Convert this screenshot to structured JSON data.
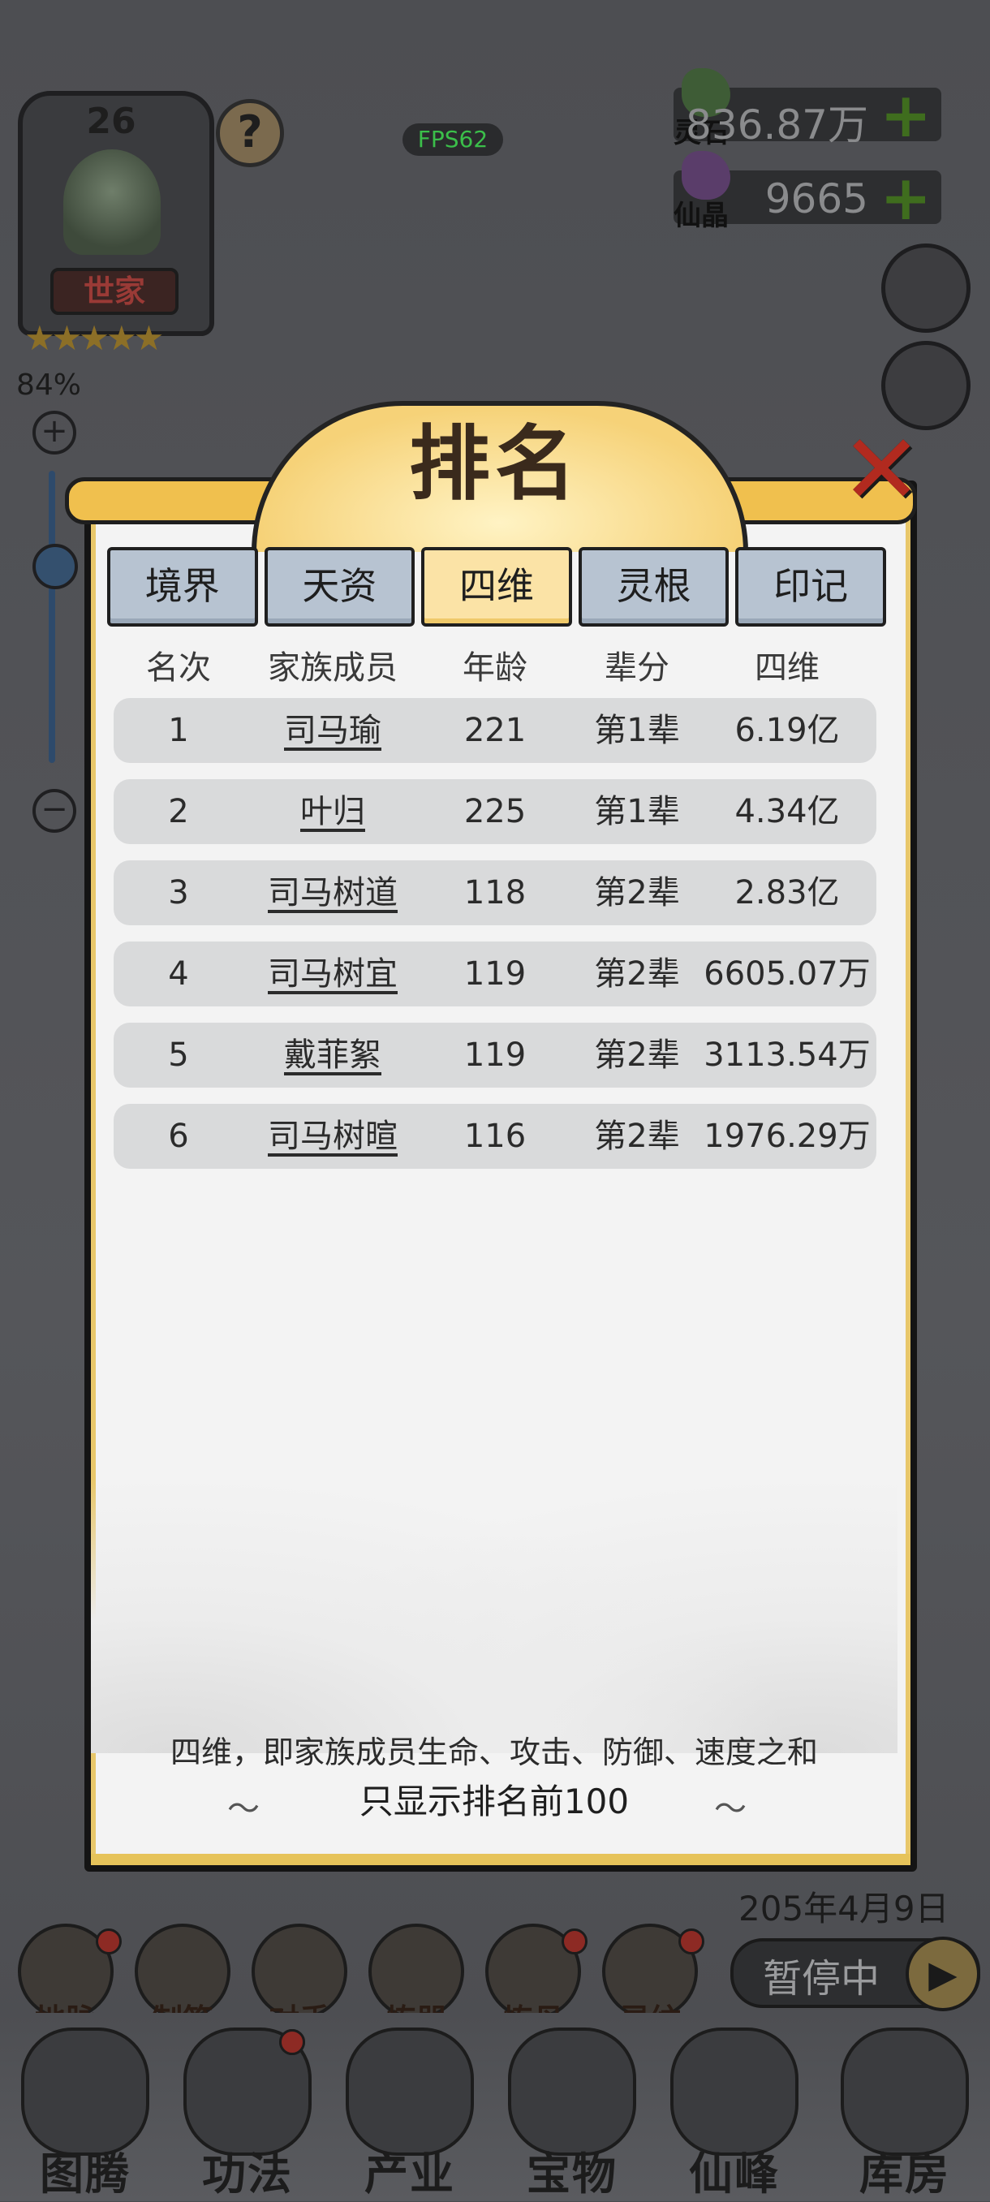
{
  "hud": {
    "level": "26",
    "family_title": "世家",
    "stars": "★★★★★",
    "percent": "84%",
    "fps": "FPS62",
    "help": "?",
    "plus_zoom": "+",
    "minus_zoom": "−"
  },
  "resources": [
    {
      "label": "灵石",
      "value": "836.87万",
      "plus": "+"
    },
    {
      "label": "仙晶",
      "value": "9665",
      "plus": "+"
    }
  ],
  "dialog": {
    "title": "排名",
    "close": "✕",
    "tabs": [
      {
        "label": "境界",
        "active": false
      },
      {
        "label": "天资",
        "active": false
      },
      {
        "label": "四维",
        "active": true
      },
      {
        "label": "灵根",
        "active": false
      },
      {
        "label": "印记",
        "active": false
      }
    ],
    "columns": [
      "名次",
      "家族成员",
      "年龄",
      "辈分",
      "四维"
    ],
    "rows": [
      {
        "rank": "1",
        "name": "司马瑜",
        "age": "221",
        "gen": "第1辈",
        "value": "6.19亿"
      },
      {
        "rank": "2",
        "name": "叶归",
        "age": "225",
        "gen": "第1辈",
        "value": "4.34亿"
      },
      {
        "rank": "3",
        "name": "司马树道",
        "age": "118",
        "gen": "第2辈",
        "value": "2.83亿"
      },
      {
        "rank": "4",
        "name": "司马树宜",
        "age": "119",
        "gen": "第2辈",
        "value": "6605.07万"
      },
      {
        "rank": "5",
        "name": "戴菲絮",
        "age": "119",
        "gen": "第2辈",
        "value": "3113.54万"
      },
      {
        "rank": "6",
        "name": "司马树暄",
        "age": "116",
        "gen": "第2辈",
        "value": "1976.29万"
      }
    ],
    "footer_note": "四维，即家族成员生命、攻击、防御、速度之和",
    "footer_limit": "只显示排名前100"
  },
  "bottom": {
    "date": "205年4月9日",
    "pause_label": "暂停中",
    "play": "▶",
    "skills": [
      "地脉",
      "制符",
      "对手",
      "炼器",
      "炼丹",
      "灵纹"
    ],
    "nav": [
      "图腾",
      "功法",
      "产业",
      "宝物",
      "仙峰",
      "库房"
    ]
  },
  "colors": {
    "tab_active": "#fbe3a6",
    "tab_inactive": "#b7c3d1",
    "row_bg": "#d9dadb",
    "close_red": "#b12a1f",
    "plus_green": "#3f6d1e"
  }
}
